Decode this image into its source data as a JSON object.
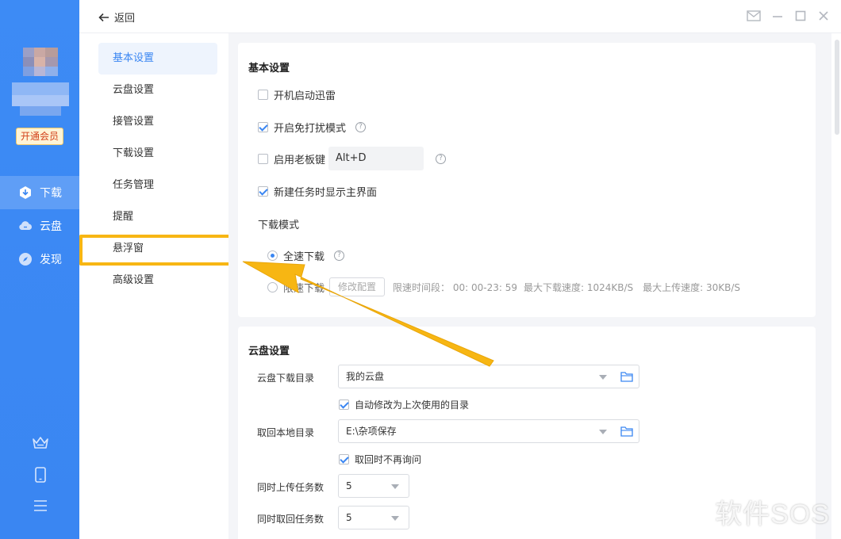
{
  "sidebar": {
    "vip_label": "开通会员",
    "nav": [
      {
        "label": "下载",
        "icon": "download-icon"
      },
      {
        "label": "云盘",
        "icon": "cloud-icon"
      },
      {
        "label": "发现",
        "icon": "compass-icon"
      }
    ],
    "bottom_icons": [
      "crown-icon",
      "phone-icon",
      "menu-icon"
    ]
  },
  "topbar": {
    "back_label": "返回",
    "window_controls": [
      "mail-icon",
      "minimize-icon",
      "maximize-icon",
      "close-icon"
    ]
  },
  "categories": {
    "items": [
      {
        "label": "基本设置",
        "active": true
      },
      {
        "label": "云盘设置"
      },
      {
        "label": "接管设置"
      },
      {
        "label": "下载设置"
      },
      {
        "label": "任务管理"
      },
      {
        "label": "提醒"
      },
      {
        "label": "悬浮窗",
        "highlighted": true
      },
      {
        "label": "高级设置"
      }
    ]
  },
  "basic": {
    "title": "基本设置",
    "autostart_label": "开机启动迅雷",
    "autostart_checked": false,
    "dnd_label": "开启免打扰模式",
    "dnd_checked": true,
    "bosskey_label": "启用老板键",
    "bosskey_checked": false,
    "bosskey_value": "Alt+D",
    "show_main_label": "新建任务时显示主界面",
    "show_main_checked": true,
    "mode_title": "下载模式",
    "mode_full_label": "全速下载",
    "mode_limit_label": "限速下载",
    "modify_btn": "修改配置",
    "limit_period": "限速时间段： 00: 00-23: 59",
    "max_down": "最大下载速度: 1024KB/S",
    "max_up": "最大上传速度: 30KB/S"
  },
  "cloud": {
    "title": "云盘设置",
    "download_dir_label": "云盘下载目录",
    "download_dir_value": "我的云盘",
    "auto_modify_label": "自动修改为上次使用的目录",
    "local_dir_label": "取回本地目录",
    "local_dir_value": "E:\\杂项保存",
    "no_ask_label": "取回时不再询问",
    "upload_tasks_label": "同时上传任务数",
    "upload_tasks_value": "5",
    "retrieve_tasks_label": "同时取回任务数",
    "retrieve_tasks_value": "5"
  },
  "watermark": "软件SOS",
  "colors": {
    "accent": "#3a86f2",
    "highlight": "#f7b613"
  }
}
